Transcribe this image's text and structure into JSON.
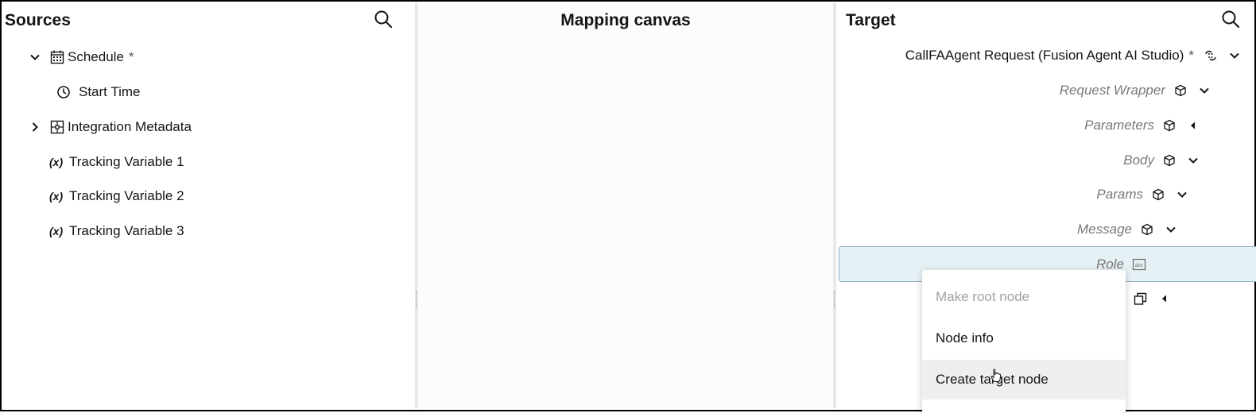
{
  "sources": {
    "title": "Sources",
    "search_icon": "search-icon",
    "items": [
      {
        "label": "Schedule",
        "required_marker": "*",
        "icon": "calendar-icon",
        "toggle": "chevron-down-icon"
      },
      {
        "label": "Start Time",
        "icon": "clock-icon"
      },
      {
        "label": "Integration Metadata",
        "icon": "metadata-icon",
        "toggle": "chevron-right-icon"
      },
      {
        "label": "Tracking Variable 1",
        "icon": "variable-icon",
        "icon_text": "(x)"
      },
      {
        "label": "Tracking Variable 2",
        "icon": "variable-icon",
        "icon_text": "(x)"
      },
      {
        "label": "Tracking Variable 3",
        "icon": "variable-icon",
        "icon_text": "(x)"
      }
    ]
  },
  "canvas": {
    "title": "Mapping canvas"
  },
  "target": {
    "title": "Target",
    "search_icon": "search-icon",
    "root": {
      "label": "CallFAAgent Request (Fusion Agent AI Studio)",
      "required_marker": "*",
      "icon": "connection-icon"
    },
    "nodes": [
      {
        "label": "Request Wrapper",
        "icon": "cube-icon",
        "toggle": "chevron-down-icon"
      },
      {
        "label": "Parameters",
        "icon": "cube-icon",
        "toggle": "caret-left-icon"
      },
      {
        "label": "Body",
        "icon": "cube-icon",
        "toggle": "chevron-down-icon"
      },
      {
        "label": "Params",
        "icon": "cube-icon",
        "toggle": "chevron-down-icon"
      },
      {
        "label": "Message",
        "icon": "cube-icon",
        "toggle": "chevron-down-icon"
      },
      {
        "label": "Role",
        "icon": "string-icon",
        "selected": true
      }
    ],
    "collapsed_row": {
      "icon": "repeating-element-icon",
      "toggle": "caret-left-icon"
    }
  },
  "context_menu": {
    "items": [
      {
        "label": "Make root node",
        "disabled": true
      },
      {
        "label": "Node info"
      },
      {
        "label": "Create target node",
        "hovered": true
      }
    ]
  },
  "colors": {
    "selected_bg": "#e6f1f6",
    "selected_border": "#8fb4c4",
    "muted_text": "#7a7876",
    "disabled_text": "#a4a19e"
  }
}
